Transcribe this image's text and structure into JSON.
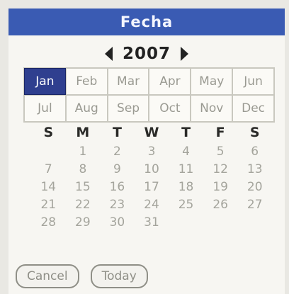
{
  "dialog": {
    "title": "Fecha",
    "year": "2007",
    "selected_month": "Jan",
    "months": [
      "Jan",
      "Feb",
      "Mar",
      "Apr",
      "May",
      "Jun",
      "Jul",
      "Aug",
      "Sep",
      "Oct",
      "Nov",
      "Dec"
    ],
    "weekdays": [
      "S",
      "M",
      "T",
      "W",
      "T",
      "F",
      "S"
    ],
    "first_weekday_index": 1,
    "days": [
      "1",
      "2",
      "3",
      "4",
      "5",
      "6",
      "7",
      "8",
      "9",
      "10",
      "11",
      "12",
      "13",
      "14",
      "15",
      "16",
      "17",
      "18",
      "19",
      "20",
      "21",
      "22",
      "23",
      "24",
      "25",
      "26",
      "27",
      "28",
      "29",
      "30",
      "31"
    ],
    "buttons": {
      "cancel": "Cancel",
      "today": "Today"
    },
    "icons": {
      "prev": "prev-year-arrow-icon",
      "next": "next-year-arrow-icon"
    },
    "colors": {
      "titlebar": "#3a5bb3",
      "selected": "#2f3f8f"
    }
  }
}
